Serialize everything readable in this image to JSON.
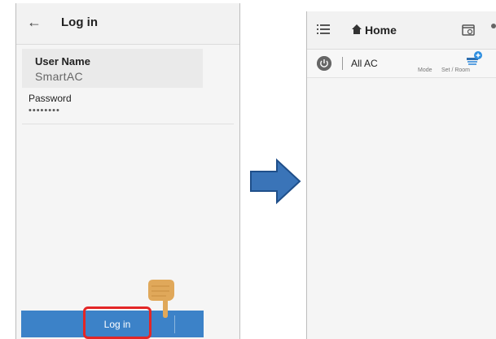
{
  "login_screen": {
    "title": "Log in",
    "username_label": "User Name",
    "username_value": "SmartAC",
    "password_label": "Password",
    "password_value": "••••••••",
    "login_button": "Log in",
    "icons": {
      "back": "back-arrow-icon",
      "pointer": "pointing-hand-icon"
    }
  },
  "home_screen": {
    "title": "Home",
    "ac_row": {
      "name": "All AC",
      "mode_label": "Mode",
      "set_room_label": "Set / Room"
    },
    "icons": {
      "menu": "menu-icon",
      "home": "home-icon",
      "calendar": "calendar-icon",
      "power": "power-icon",
      "add_ac": "fan-add-icon"
    }
  },
  "colors": {
    "login_button": "#3c82c8",
    "highlight": "#e32626",
    "arrow": "#3a74b8",
    "hand": "#e0a85a"
  }
}
